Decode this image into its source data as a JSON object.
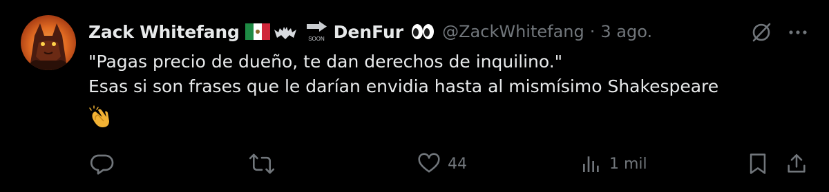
{
  "tweet": {
    "author": {
      "display_name": "Zack Whitefang",
      "display_name_suffix": "DenFur",
      "handle": "@ZackWhitefang",
      "badges": [
        "mexico-flag-icon",
        "bat-icon",
        "soon-arrow-icon",
        "eyes-icon"
      ]
    },
    "separator": "·",
    "date": "3 ago.",
    "text_lines": [
      "\"Pagas precio de dueño, te dan derechos de inquilino.\"",
      "Esas si son frases que le darían envidia hasta al mismísimo Shakespeare"
    ],
    "emoji": "clapping-hands-icon",
    "icons": {
      "grok": "grok-slash-icon",
      "more": "more-dots-icon"
    },
    "actions": {
      "reply": {
        "icon": "reply-icon",
        "count": ""
      },
      "retweet": {
        "icon": "retweet-icon",
        "count": ""
      },
      "like": {
        "icon": "heart-icon",
        "count": "44"
      },
      "views": {
        "icon": "views-chart-icon",
        "count": "1 mil"
      },
      "bookmark": {
        "icon": "bookmark-icon"
      },
      "share": {
        "icon": "share-icon"
      }
    }
  },
  "colors": {
    "background": "#000000",
    "text_primary": "#e7e9ea",
    "text_secondary": "#71767b"
  }
}
